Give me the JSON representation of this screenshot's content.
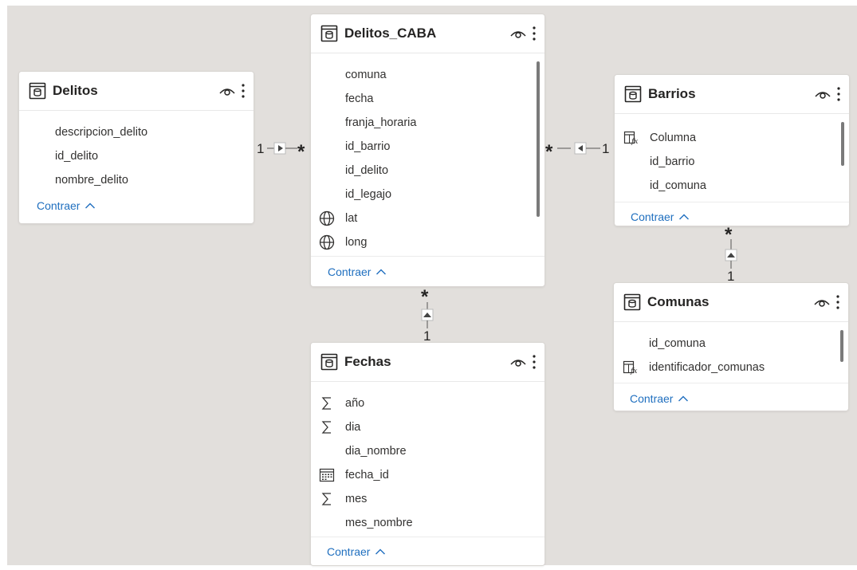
{
  "tables": {
    "delitos": {
      "title": "Delitos",
      "fields": [
        "descripcion_delito",
        "id_delito",
        "nombre_delito"
      ],
      "collapse_label": "Contraer"
    },
    "delitos_caba": {
      "title": "Delitos_CABA",
      "fields": [
        "comuna",
        "fecha",
        "franja_horaria",
        "id_barrio",
        "id_delito",
        "id_legajo",
        "lat",
        "long"
      ],
      "field_icons": [
        "",
        "",
        "",
        "",
        "",
        "",
        "globe-icon",
        "globe-icon"
      ],
      "collapse_label": "Contraer"
    },
    "barrios": {
      "title": "Barrios",
      "fields": [
        "Columna",
        "id_barrio",
        "id_comuna"
      ],
      "field_icons": [
        "calculated-column-icon",
        "",
        ""
      ],
      "collapse_label": "Contraer"
    },
    "comunas": {
      "title": "Comunas",
      "fields": [
        "id_comuna",
        "identificador_comunas"
      ],
      "field_icons": [
        "",
        "calculated-column-icon"
      ],
      "collapse_label": "Contraer"
    },
    "fechas": {
      "title": "Fechas",
      "fields": [
        "año",
        "dia",
        "dia_nombre",
        "fecha_id",
        "mes",
        "mes_nombre"
      ],
      "field_icons": [
        "sigma-icon",
        "sigma-icon",
        "",
        "calendar-icon",
        "sigma-icon",
        ""
      ],
      "collapse_label": "Contraer"
    }
  },
  "relationships": {
    "delitos_to_caba": {
      "from_label": "1",
      "to_label": "*"
    },
    "barrios_to_caba": {
      "from_label": "1",
      "to_label": "*"
    },
    "fechas_to_caba": {
      "from_label": "1",
      "to_label": "*"
    },
    "comunas_to_barrios": {
      "from_label": "1",
      "to_label": "*"
    }
  },
  "colors": {
    "canvas": "#e2dfdc",
    "card": "#ffffff",
    "link": "#1f6fbf",
    "text": "#252423"
  }
}
